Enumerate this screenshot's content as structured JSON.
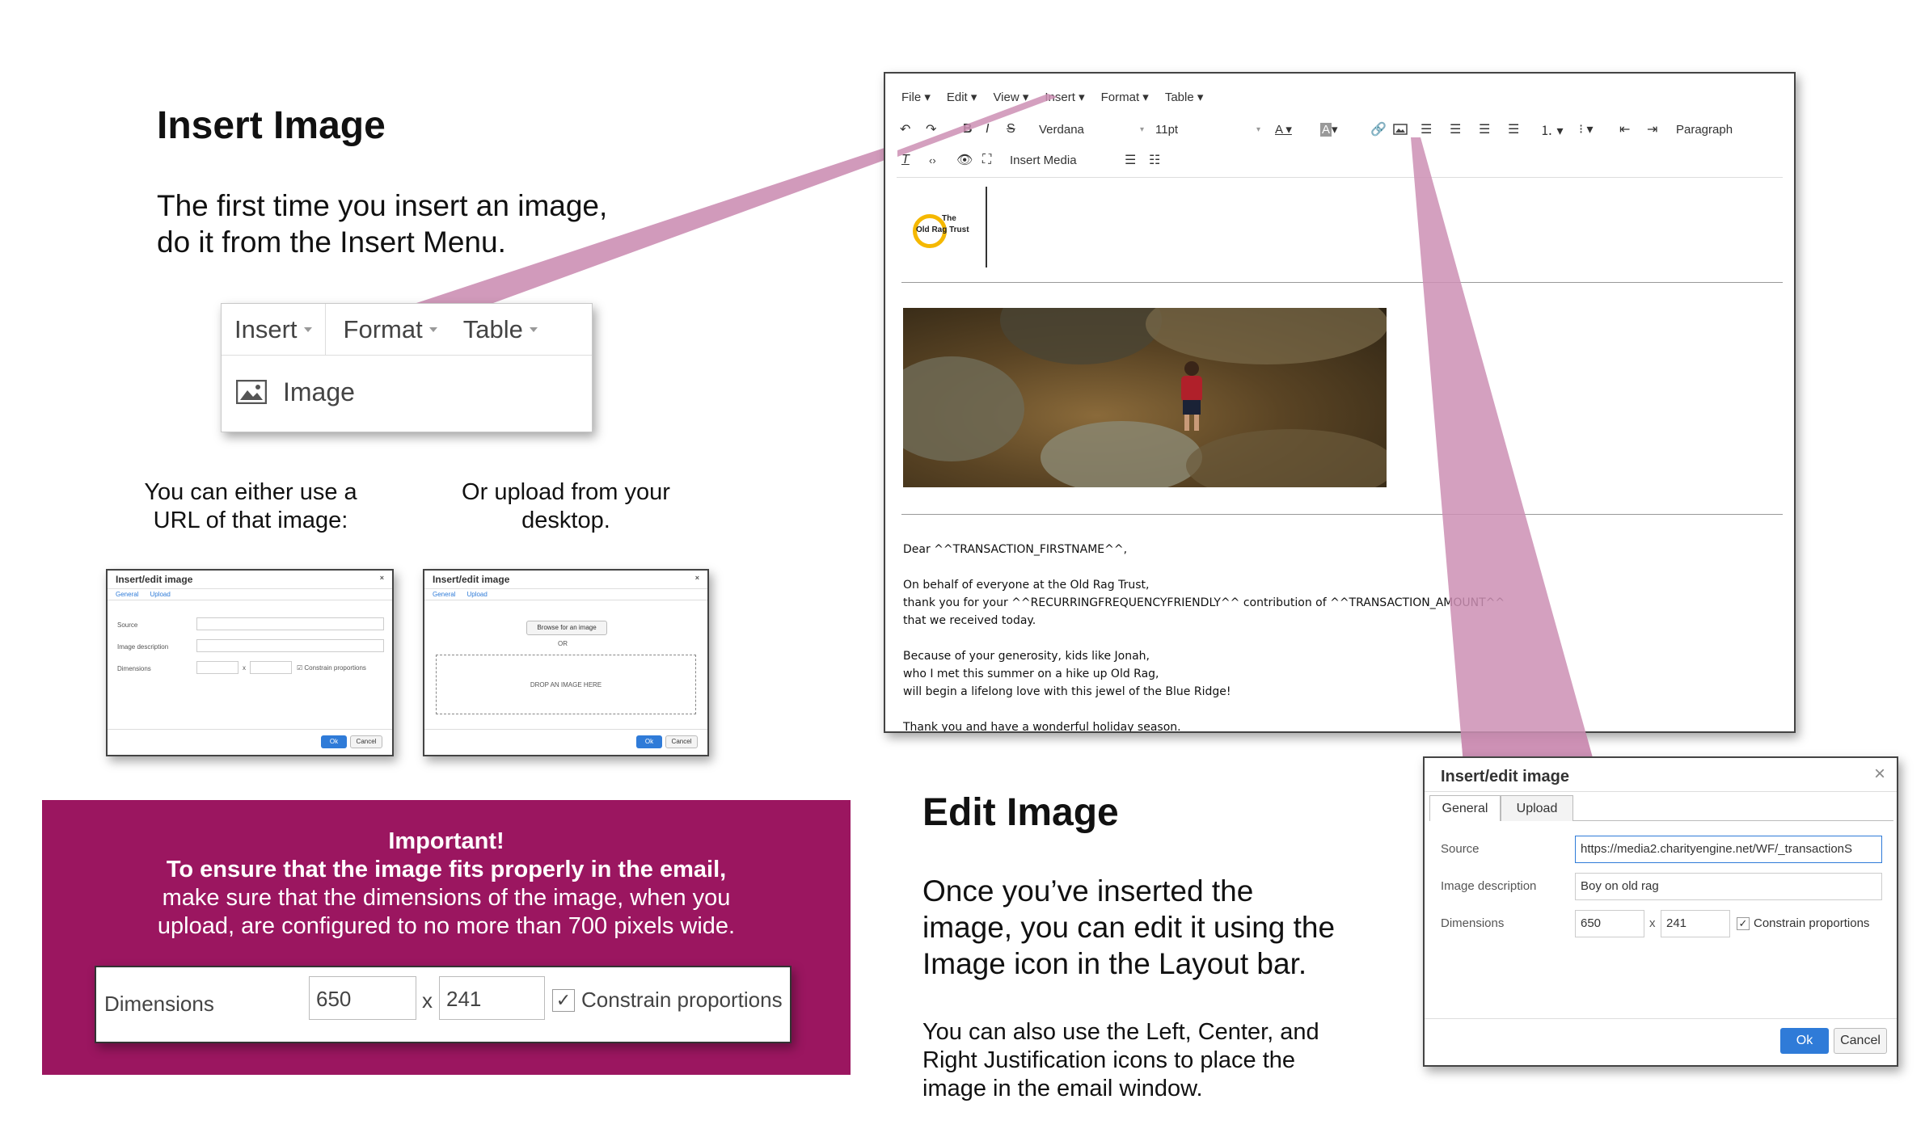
{
  "insert_section": {
    "title": "Insert Image",
    "intro_line1": "The first time you insert an image,",
    "intro_line2": "do it from the Insert Menu.",
    "menu": {
      "items": [
        "Insert",
        "Format",
        "Table"
      ],
      "dropdown_item": "Image"
    },
    "url_caption_line1": "You can either use a",
    "url_caption_line2": "URL of that image:",
    "upload_caption_line1": "Or upload from your",
    "upload_caption_line2": "desktop.",
    "dialog_url": {
      "title": "Insert/edit image",
      "tabs": [
        "General",
        "Upload"
      ],
      "labels": [
        "Source",
        "Image description",
        "Dimensions"
      ],
      "constrain": "Constrain proportions",
      "ok": "Ok",
      "cancel": "Cancel",
      "x": "x"
    },
    "dialog_upload": {
      "title": "Insert/edit image",
      "tabs": [
        "General",
        "Upload"
      ],
      "browse": "Browse for an image",
      "or": "OR",
      "drop": "DROP AN IMAGE HERE",
      "ok": "Ok",
      "cancel": "Cancel"
    }
  },
  "important_box": {
    "heading": "Important!",
    "bold_line": "To ensure that the image fits properly in the email,",
    "line2": "make sure that the dimensions of the image, when you",
    "line3": "upload, are configured to no more than 700 pixels wide.",
    "dims_label": "Dimensions",
    "width": "650",
    "x": "x",
    "height": "241",
    "constrain": "Constrain proportions",
    "bg_color": "#9b1660"
  },
  "editor": {
    "menubar": [
      "File",
      "Edit",
      "View",
      "Insert",
      "Format",
      "Table"
    ],
    "font_family": "Verdana",
    "font_size": "11pt",
    "block_format": "Paragraph",
    "insert_media_label": "Insert Media",
    "logo_text_line1": "The",
    "logo_text_line2": "Old Rag Trust",
    "body_lines": [
      "Dear ^^TRANSACTION_FIRSTNAME^^,",
      "",
      "On behalf of everyone at the Old Rag Trust,",
      "thank you for your ^^RECURRINGFREQUENCYFRIENDLY^^ contribution of ^^TRANSACTION_AMOUNT^^",
      "that we received today.",
      "",
      "Because of your generosity, kids like Jonah,",
      "who I met this summer on a hike up Old Rag,",
      "will begin a lifelong love with this jewel of the Blue Ridge!",
      "",
      "Thank you and have a wonderful holiday season."
    ]
  },
  "edit_section": {
    "title": "Edit Image",
    "line1": "Once you’ve inserted the",
    "line2": "image, you can edit it using the",
    "line3": "Image icon in the Layout bar.",
    "note1": "You can also use the Left, Center, and",
    "note2": "Right Justification icons to place the",
    "note3": "image in the email window."
  },
  "edit_dialog": {
    "title": "Insert/edit image",
    "close": "×",
    "tabs": [
      "General",
      "Upload"
    ],
    "source_label": "Source",
    "source_value": "https://media2.charityengine.net/WF/_transactionS",
    "desc_label": "Image description",
    "desc_value": "Boy on old rag",
    "dims_label": "Dimensions",
    "width": "650",
    "x": "x",
    "height": "241",
    "constrain": "Constrain proportions",
    "ok": "Ok",
    "cancel": "Cancel"
  },
  "colors": {
    "callout": "#cc8fb4",
    "accent_blue": "#2f7bd8",
    "important_bg": "#9b1660"
  }
}
